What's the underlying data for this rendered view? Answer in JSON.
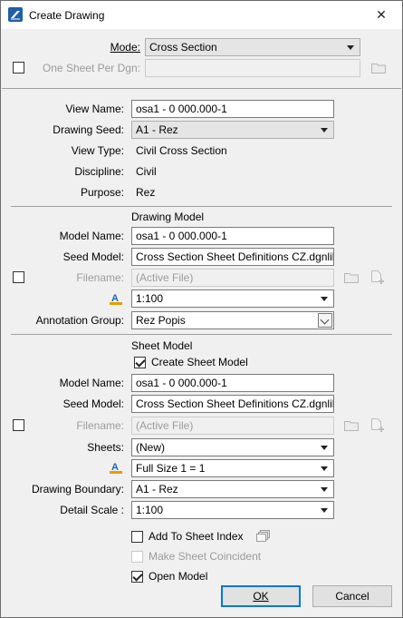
{
  "window": {
    "title": "Create Drawing",
    "close_glyph": "✕"
  },
  "mode": {
    "label": "Mode:",
    "value": "Cross Section"
  },
  "one_sheet": {
    "label": "One Sheet Per Dgn:",
    "value": ""
  },
  "view": {
    "name_label": "View Name:",
    "name_value": "osa1 - 0 000.000-1",
    "seed_label": "Drawing Seed:",
    "seed_value": "A1 - Rez",
    "type_label": "View Type:",
    "type_value": "Civil Cross Section",
    "discipline_label": "Discipline:",
    "discipline_value": "Civil",
    "purpose_label": "Purpose:",
    "purpose_value": "Rez"
  },
  "drawing_model": {
    "section_title": "Drawing Model",
    "model_name_label": "Model Name:",
    "model_name_value": "osa1 - 0 000.000-1",
    "seed_model_label": "Seed Model:",
    "seed_model_value": "Cross Section Sheet Definitions CZ.dgnlib",
    "filename_label": "Filename:",
    "filename_placeholder": "(Active File)",
    "scale_value": "1:100",
    "annotation_label": "Annotation Group:",
    "annotation_value": "Rez Popis"
  },
  "sheet_model": {
    "section_title": "Sheet Model",
    "create_label": "Create Sheet Model",
    "model_name_label": "Model Name:",
    "model_name_value": "osa1 - 0 000.000-1",
    "seed_model_label": "Seed Model:",
    "seed_model_value": "Cross Section Sheet Definitions CZ.dgnlib",
    "filename_label": "Filename:",
    "filename_placeholder": "(Active File)",
    "sheets_label": "Sheets:",
    "sheets_value": "(New)",
    "annotation_scale_value": "Full Size 1 = 1",
    "boundary_label": "Drawing Boundary:",
    "boundary_value": "A1 - Rez",
    "detail_label": "Detail Scale :",
    "detail_value": "1:100"
  },
  "options": {
    "add_to_index": "Add To Sheet Index",
    "make_coincident": "Make Sheet Coincident",
    "open_model": "Open Model"
  },
  "buttons": {
    "ok": "OK",
    "cancel": "Cancel"
  },
  "colors": {
    "accent": "#0078d7",
    "disabled_text": "#9b9b9b"
  }
}
